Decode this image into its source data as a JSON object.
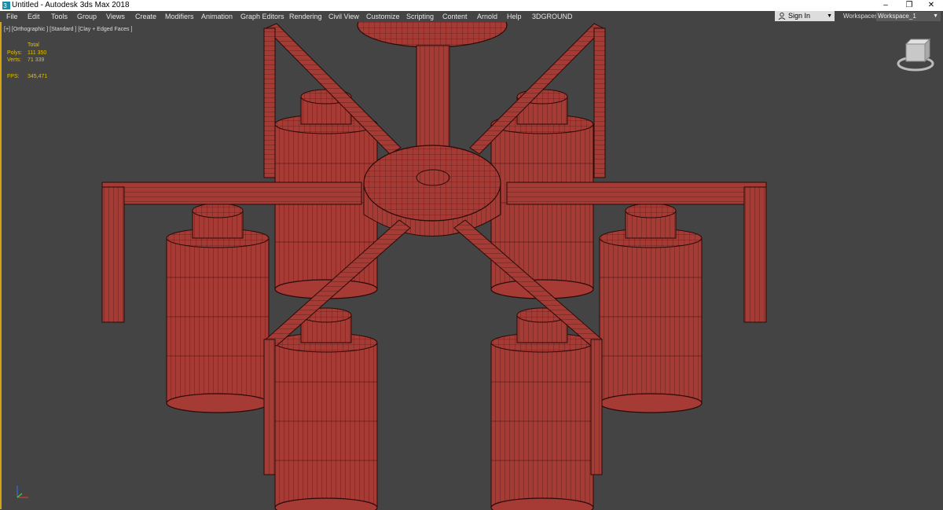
{
  "window": {
    "title": "Untitled - Autodesk 3ds Max 2018",
    "minimize": "–",
    "maximize": "❐",
    "close": "✕"
  },
  "menu": [
    "File",
    "Edit",
    "Tools",
    "Group",
    "Views",
    "Create",
    "Modifiers",
    "Animation",
    "Graph Editors",
    "Rendering",
    "Civil View",
    "Customize",
    "Scripting",
    "Content",
    "Arnold",
    "Help",
    "3DGROUND"
  ],
  "signin": {
    "label": "Sign In",
    "icon": "user-icon",
    "caret": "▼"
  },
  "workspaces": {
    "label": "Workspaces:",
    "value": "Workspace_1",
    "caret": "▼"
  },
  "viewport": {
    "label": "[+] [Orthographic ] [Standard ] [Clay + Edged Faces ]",
    "stats": {
      "header": "Total",
      "polys_label": "Polys:",
      "polys_value": "111 350",
      "verts_label": "Verts:",
      "verts_value": "71 339",
      "fps_label": "FPS:",
      "fps_value": "345,471"
    },
    "clay_color": "#a63a34",
    "wire_color": "#3a0f0c",
    "viewcube_icon": "viewcube-icon",
    "axis_icon": "axis-tripod-icon"
  }
}
